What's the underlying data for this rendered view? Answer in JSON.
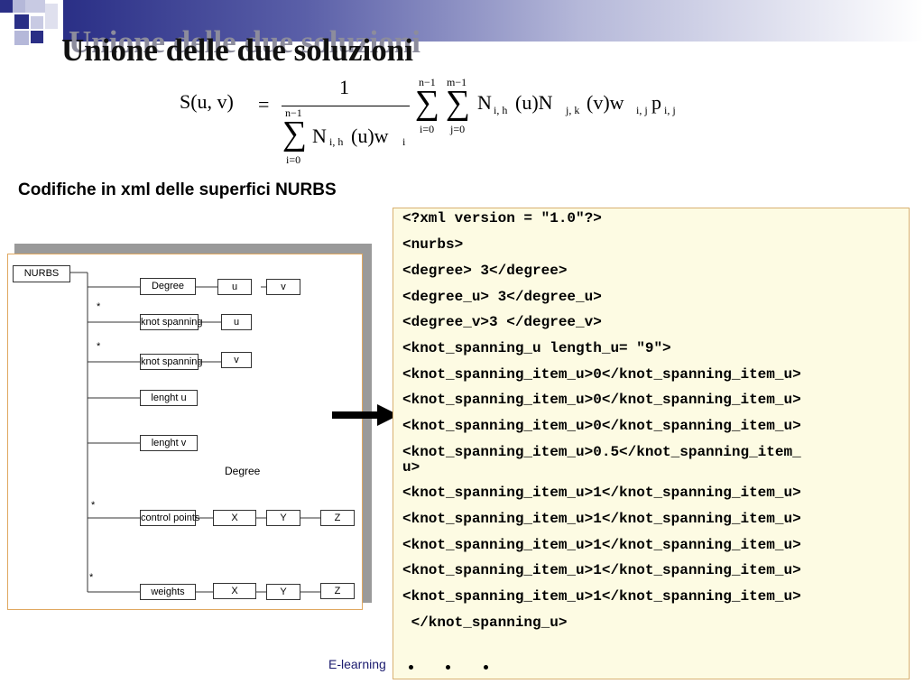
{
  "slide": {
    "title": "Unione delle due soluzioni",
    "subtitle": "Codifiche in xml delle superfici NURBS",
    "footer": "E-learning",
    "accent_color": "#2a2f86",
    "ellipsis": "• • •"
  },
  "formula": {
    "lhs": "S(u, v)",
    "equals": "=",
    "numerator": "1",
    "denom_sum_top": "n−1",
    "denom_sum_bottom": "i=0",
    "denom_term": "N",
    "denom_term_sub": "i, h",
    "denom_term_arg": "(u)w",
    "denom_term_arg_sub": "i",
    "sum1_top": "n−1",
    "sum1_bottom": "i=0",
    "sum2_top": "m−1",
    "sum2_bottom": "j=0",
    "sigma": "∑",
    "term_n1": "N",
    "term_n1_sub": "i, h",
    "term_arg1": "(u)N",
    "term_n2_sub": "j, k",
    "term_arg2": "(v)w",
    "term_w_sub": "i, j",
    "term_p": "p",
    "term_p_sub": "i, j"
  },
  "diagram": {
    "root": "NURBS",
    "degree_box": "Degree",
    "degree_u": "u",
    "degree_v": "v",
    "knot_u_box": "knot spanning",
    "knot_u_child": "u",
    "knot_v_box": "knot spanning",
    "knot_v_child": "v",
    "lenght_u": "lenght u",
    "lenght_v": "lenght v",
    "degree_label": "Degree",
    "control_points": "control points",
    "cp_x": "X",
    "cp_y": "Y",
    "cp_z": "Z",
    "weights": "weights",
    "w_x": "X",
    "w_y": "Y",
    "w_z": "Z",
    "star": "*"
  },
  "xml_lines": [
    "<?xml version = \"1.0\"?>",
    "<nurbs>",
    "<degree> 3</degree>",
    "<degree_u> 3</degree_u>",
    "<degree_v>3 </degree_v>",
    "<knot_spanning_u length_u= \"9\">",
    "<knot_spanning_item_u>0</knot_spanning_item_u>",
    "<knot_spanning_item_u>0</knot_spanning_item_u>",
    "<knot_spanning_item_u>0</knot_spanning_item_u>",
    "<knot_spanning_item_u>0.5</knot_spanning_item_",
    "u>",
    "<knot_spanning_item_u>1</knot_spanning_item_u>",
    "<knot_spanning_item_u>1</knot_spanning_item_u>",
    "<knot_spanning_item_u>1</knot_spanning_item_u>",
    "<knot_spanning_item_u>1</knot_spanning_item_u>",
    "<knot_spanning_item_u>1</knot_spanning_item_u>",
    " </knot_spanning_u>"
  ]
}
